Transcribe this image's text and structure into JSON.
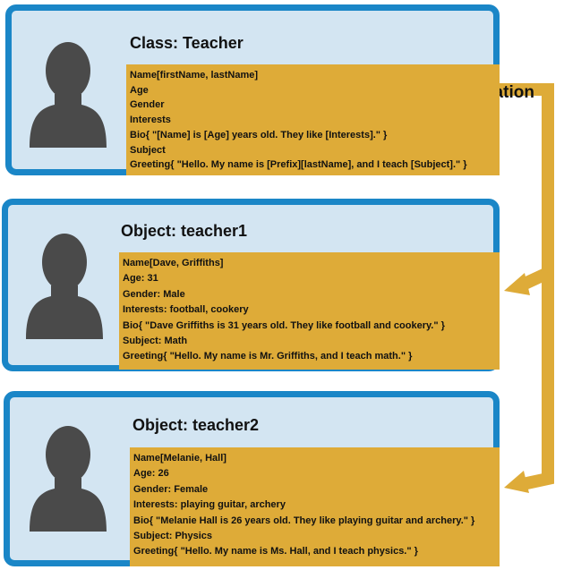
{
  "arrow_label": "Instantiation",
  "colors": {
    "border": "#1a86c7",
    "card_bg": "#d3e5f2",
    "props_bg": "#deab38",
    "arrow": "#deab38",
    "avatar": "#4a4a4a"
  },
  "cards": [
    {
      "title": "Class: Teacher",
      "icon": "person-silhouette-icon",
      "properties": [
        "Name[firstName, lastName]",
        "Age",
        "Gender",
        "Interests",
        "Bio{ \"[Name] is [Age] years old. They like [Interests].\" }",
        "Subject",
        "Greeting{ \"Hello. My name is [Prefix][lastName], and I teach [Subject].\" }"
      ]
    },
    {
      "title": "Object: teacher1",
      "icon": "person-silhouette-icon",
      "properties": [
        "Name[Dave, Griffiths]",
        "Age: 31",
        "Gender: Male",
        "Interests: football, cookery",
        "Bio{ \"Dave Griffiths is 31 years old. They like football and cookery.\" }",
        "Subject: Math",
        "Greeting{ \"Hello. My name is Mr. Griffiths, and I teach math.\" }"
      ]
    },
    {
      "title": "Object: teacher2",
      "icon": "person-silhouette-icon",
      "properties": [
        "Name[Melanie, Hall]",
        "Age: 26",
        "Gender: Female",
        "Interests: playing guitar, archery",
        "Bio{ \"Melanie Hall is 26 years old. They like playing guitar and archery.\" }",
        "Subject: Physics",
        "Greeting{ \"Hello. My name is Ms. Hall, and I teach physics.\" }"
      ]
    }
  ]
}
